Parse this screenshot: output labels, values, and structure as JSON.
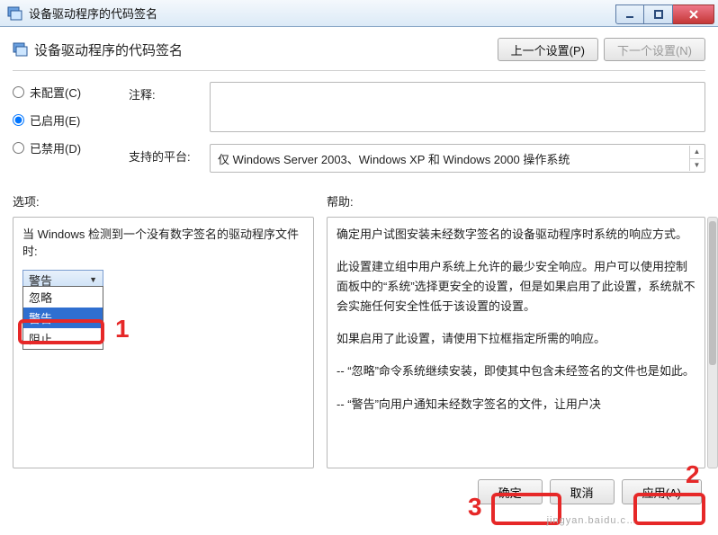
{
  "window": {
    "title": "设备驱动程序的代码签名"
  },
  "header": {
    "title": "设备驱动程序的代码签名",
    "prev": "上一个设置(P)",
    "next": "下一个设置(N)"
  },
  "radios": {
    "unconfigured": "未配置(C)",
    "enabled": "已启用(E)",
    "disabled": "已禁用(D)",
    "selected": "enabled"
  },
  "fields": {
    "comment_label": "注释:",
    "comment_value": "",
    "platform_label": "支持的平台:",
    "platform_value": "仅 Windows Server 2003、Windows XP 和 Windows 2000 操作系统"
  },
  "sections": {
    "options_label": "选项:",
    "help_label": "帮助:"
  },
  "options": {
    "prompt_line": "当 Windows 检测到一个没有数字签名的驱动程序文件时:",
    "selected": "警告",
    "items": [
      "忽略",
      "警告",
      "阻止"
    ]
  },
  "help": {
    "p1": "确定用户试图安装未经数字签名的设备驱动程序时系统的响应方式。",
    "p2": "此设置建立组中用户系统上允许的最少安全响应。用户可以使用控制面板中的“系统”选择更安全的设置，但是如果启用了此设置，系统就不会实施任何安全性低于该设置的设置。",
    "p3": "如果启用了此设置，请使用下拉框指定所需的响应。",
    "p4": "-- “忽略”命令系统继续安装，即使其中包含未经签名的文件也是如此。",
    "p5": "-- “警告”向用户通知未经数字签名的文件，让用户决"
  },
  "footer": {
    "ok": "确定",
    "cancel": "取消",
    "apply": "应用(A)"
  },
  "annotations": {
    "a1": "1",
    "a2": "2",
    "a3": "3"
  },
  "watermark": "jingyan.baidu.c…"
}
